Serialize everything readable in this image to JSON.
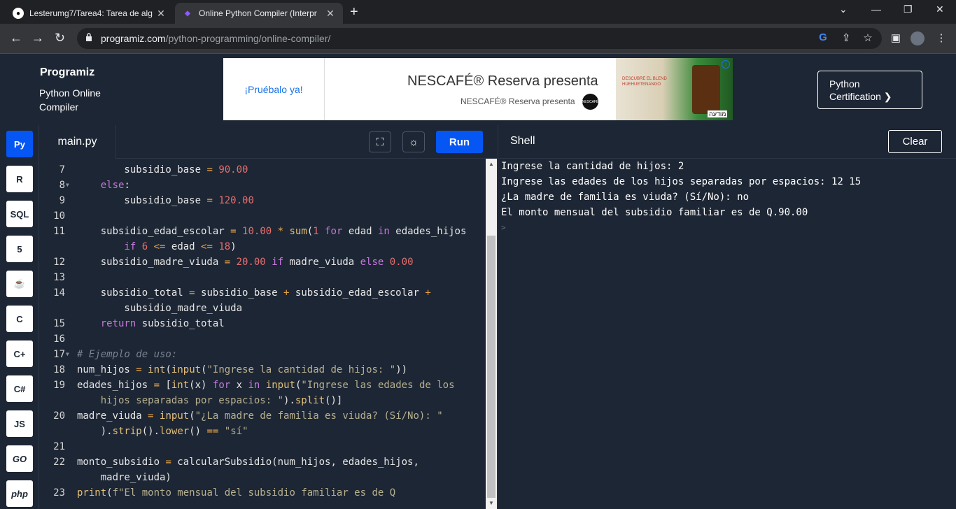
{
  "browser": {
    "tabs": [
      {
        "title": "Lesterumg7/Tarea4: Tarea de alg",
        "icon": "github-icon",
        "active": false
      },
      {
        "title": "Online Python Compiler (Interpr",
        "icon": "programiz-icon",
        "active": true
      }
    ],
    "new_tab": "+",
    "url_host": "programiz.com",
    "url_path": "/python-programming/online-compiler/"
  },
  "header": {
    "logo": "Programiz",
    "subtitle": "Python Online Compiler",
    "certification": "Python Certification ❯"
  },
  "ad": {
    "cta": "¡Pruébalo ya!",
    "headline": "NESCAFÉ® Reserva presenta",
    "subline": "NESCAFÉ® Reserva presenta",
    "brand_badge": "NESCAFÉ",
    "image_text": "DESCUBRE EL BLEND HUEHUETENANGO",
    "image_badge": "מודעה",
    "info": "i"
  },
  "sidebar": {
    "languages": [
      {
        "name": "python",
        "label": "Py",
        "active": true
      },
      {
        "name": "r",
        "label": "R",
        "active": false
      },
      {
        "name": "sql",
        "label": "SQL",
        "active": false
      },
      {
        "name": "html",
        "label": "5",
        "active": false
      },
      {
        "name": "java",
        "label": "☕",
        "active": false
      },
      {
        "name": "c",
        "label": "C",
        "active": false
      },
      {
        "name": "cpp",
        "label": "C+",
        "active": false
      },
      {
        "name": "csharp",
        "label": "C#",
        "active": false
      },
      {
        "name": "js",
        "label": "JS",
        "active": false
      },
      {
        "name": "go",
        "label": "GO",
        "active": false
      },
      {
        "name": "php",
        "label": "php",
        "active": false
      }
    ]
  },
  "editor": {
    "filename": "main.py",
    "run_label": "Run",
    "fullscreen_icon": "⛶",
    "theme_icon": "☼"
  },
  "shell": {
    "title": "Shell",
    "clear_label": "Clear",
    "lines": [
      "Ingrese la cantidad de hijos: 2",
      "Ingrese las edades de los hijos separadas por espacios: 12 15",
      "¿La madre de familia es viuda? (Sí/No): no",
      "El monto mensual del subsidio familiar es de Q.90.00"
    ],
    "prompt": ">"
  },
  "code": {
    "line_numbers": [
      "7",
      "8",
      "9",
      "10",
      "11",
      "",
      "12",
      "13",
      "14",
      "",
      "15",
      "16",
      "17",
      "18",
      "19",
      "",
      "20",
      "",
      "21",
      "22",
      "",
      "23"
    ]
  }
}
